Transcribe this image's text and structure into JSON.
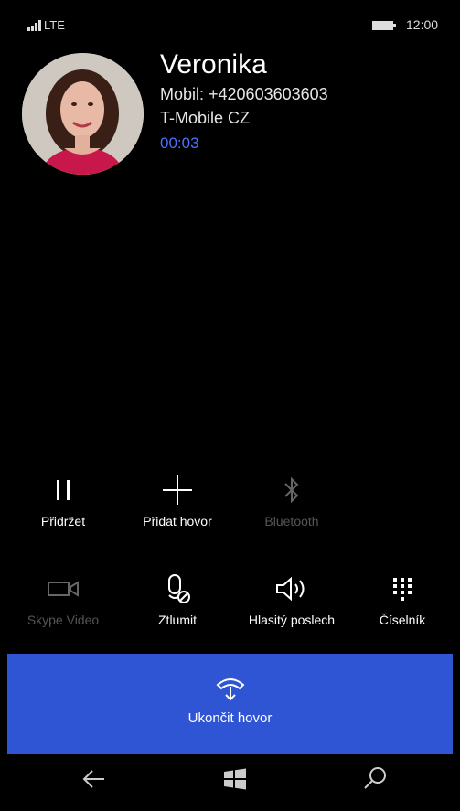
{
  "status_bar": {
    "network": "LTE",
    "time": "12:00"
  },
  "contact": {
    "name": "Veronika",
    "number": "Mobil: +420603603603",
    "carrier": "T-Mobile CZ",
    "duration": "00:03"
  },
  "controls_row1": [
    {
      "label": "Přidržet",
      "icon": "pause-icon",
      "enabled": true
    },
    {
      "label": "Přidat hovor",
      "icon": "plus-icon",
      "enabled": true
    },
    {
      "label": "Bluetooth",
      "icon": "bluetooth-icon",
      "enabled": false
    }
  ],
  "controls_row2": [
    {
      "label": "Skype Video",
      "icon": "video-icon",
      "enabled": false
    },
    {
      "label": "Ztlumit",
      "icon": "mute-icon",
      "enabled": true
    },
    {
      "label": "Hlasitý poslech",
      "icon": "speaker-icon",
      "enabled": true
    },
    {
      "label": "Číselník",
      "icon": "keypad-icon",
      "enabled": true
    }
  ],
  "end_call": {
    "label": "Ukončit hovor",
    "icon": "hang-up-icon"
  },
  "nav": [
    "back-icon",
    "windows-icon",
    "search-icon"
  ],
  "colors": {
    "accent": "#2f55d4",
    "timer": "#4a72ff",
    "background": "#000000"
  }
}
